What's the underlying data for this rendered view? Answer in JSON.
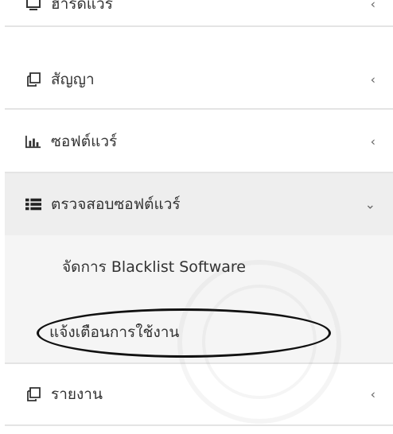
{
  "menu": {
    "items": [
      {
        "label": "ฮาร์ดแวร์",
        "icon": "monitor-icon",
        "chevron": "‹"
      },
      {
        "label": "สัญญา",
        "icon": "copy-icon",
        "chevron": "‹"
      },
      {
        "label": "ซอฟต์แวร์",
        "icon": "bar-chart-icon",
        "chevron": "‹"
      },
      {
        "label": "ตรวจสอบซอฟต์แวร์",
        "icon": "list-icon",
        "chevron": "⌄"
      }
    ],
    "submenu": [
      {
        "label": "จัดการ Blacklist Software"
      },
      {
        "label": "แจ้งเตือนการใช้งาน"
      }
    ],
    "report": {
      "label": "รายงาน",
      "icon": "copy-icon",
      "chevron": "‹"
    }
  }
}
